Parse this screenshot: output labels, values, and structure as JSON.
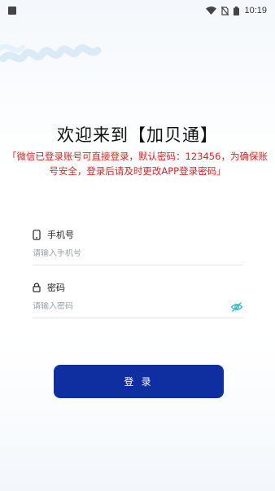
{
  "status_bar": {
    "time": "10:19"
  },
  "login": {
    "title": "欢迎来到【加贝通】",
    "notice": "「微信已登录账号可直接登录，默认密码：123456，为确保账号安全，登录后请及时更改APP登录密码」",
    "phone": {
      "label": "手机号",
      "placeholder": "请输入手机号",
      "value": ""
    },
    "password": {
      "label": "密码",
      "placeholder": "请输入密码",
      "value": ""
    },
    "submit_label": "登 录"
  },
  "colors": {
    "accent": "#0f2fa1",
    "notice": "#e01f1f",
    "eye_icon": "#35b6c9"
  }
}
